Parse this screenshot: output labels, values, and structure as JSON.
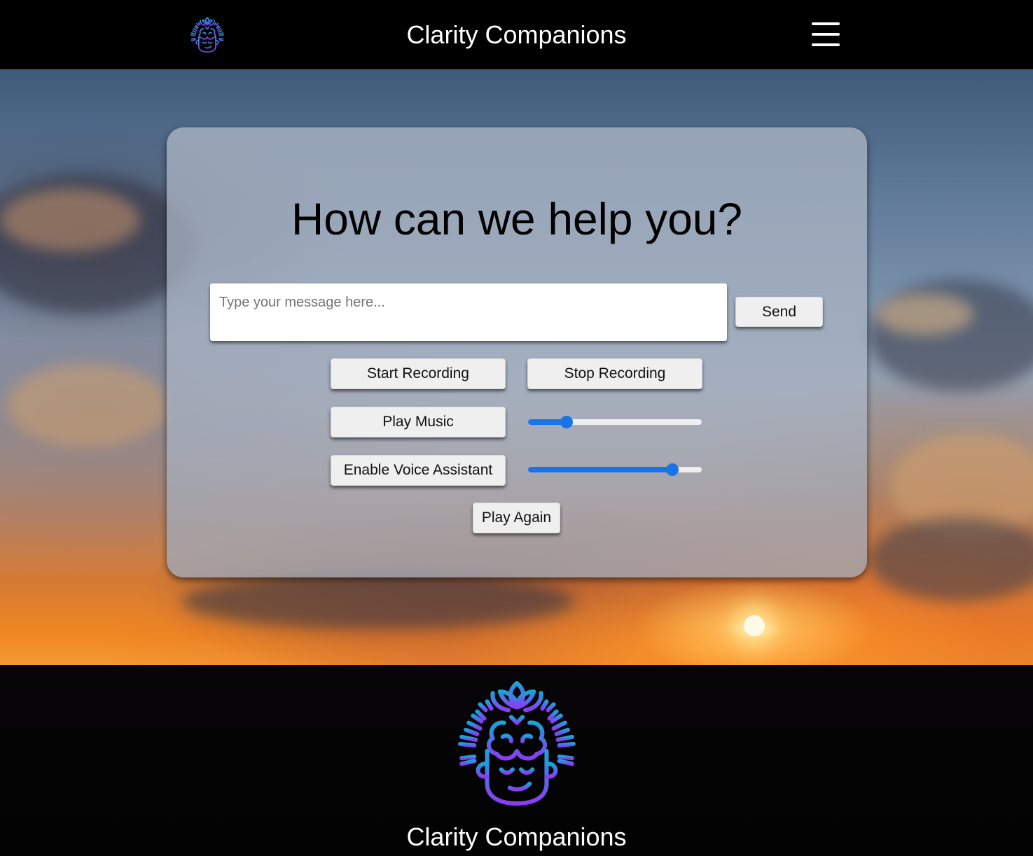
{
  "header": {
    "logo_icon": "meditating-head-lotus-logo-icon",
    "title": "Clarity Companions",
    "menu_icon": "hamburger-menu-icon"
  },
  "main": {
    "heading": "How can we help you?",
    "message_input": {
      "placeholder": "Type your message here...",
      "value": ""
    },
    "send_label": "Send",
    "start_recording_label": "Start Recording",
    "stop_recording_label": "Stop Recording",
    "play_music_label": "Play Music",
    "music_volume": 0.22,
    "enable_voice_label": "Enable Voice Assistant",
    "voice_level": 0.83,
    "play_again_label": "Play Again"
  },
  "footer": {
    "logo_icon": "meditating-head-lotus-logo-icon",
    "title": "Clarity Companions"
  },
  "colors": {
    "accent": "#1a73e8",
    "logo_gradient_top": "#1ba0d8",
    "logo_gradient_bottom": "#8a3cf0",
    "header_bg": "#000000",
    "button_bg": "#efefef"
  }
}
